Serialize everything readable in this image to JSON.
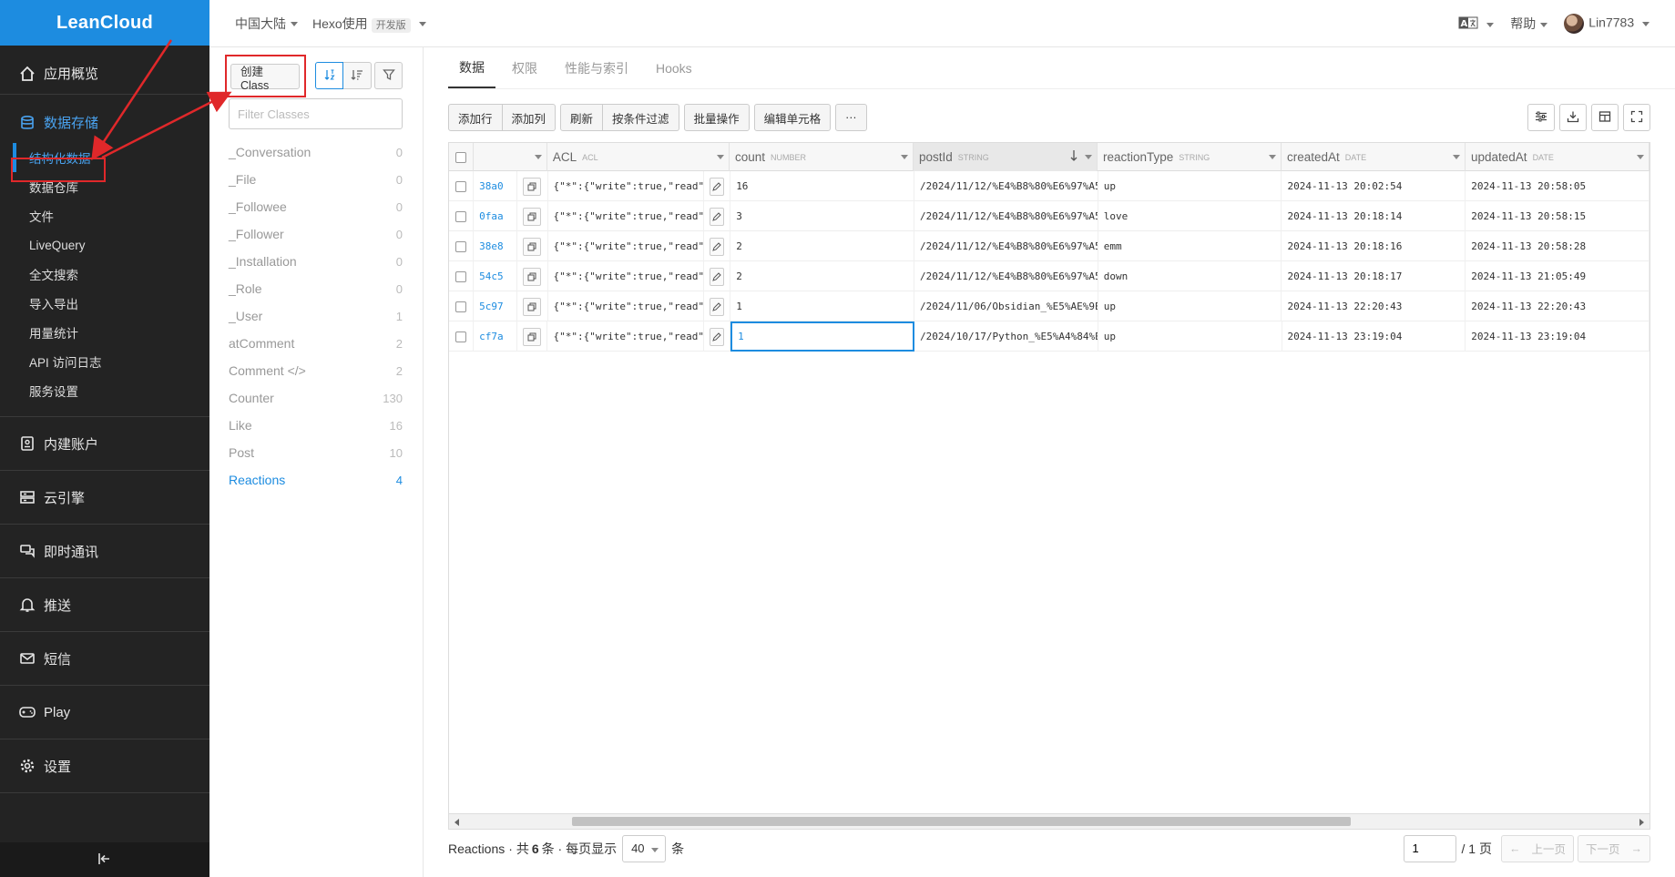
{
  "sidebar": {
    "logo": "LeanCloud",
    "overview": "应用概览",
    "storage": "数据存储",
    "storage_items": [
      {
        "label": "结构化数据"
      },
      {
        "label": "数据仓库"
      },
      {
        "label": "文件"
      },
      {
        "label": "LiveQuery"
      },
      {
        "label": "全文搜索"
      },
      {
        "label": "导入导出"
      },
      {
        "label": "用量统计"
      },
      {
        "label": "API 访问日志"
      },
      {
        "label": "服务设置"
      }
    ],
    "sections": [
      {
        "label": "内建账户"
      },
      {
        "label": "云引擎"
      },
      {
        "label": "即时通讯"
      },
      {
        "label": "推送"
      },
      {
        "label": "短信"
      },
      {
        "label": "Play"
      },
      {
        "label": "设置"
      }
    ]
  },
  "topbar": {
    "region": "中国大陆",
    "app": "Hexo使用",
    "app_badge": "开发版",
    "help": "帮助",
    "user": "Lin7783",
    "lang_icon": "translate-icon"
  },
  "classes": {
    "create_label": "创建 Class",
    "filter_placeholder": "Filter Classes",
    "items": [
      {
        "name": "_Conversation",
        "count": "0"
      },
      {
        "name": "_File",
        "count": "0"
      },
      {
        "name": "_Followee",
        "count": "0"
      },
      {
        "name": "_Follower",
        "count": "0"
      },
      {
        "name": "_Installation",
        "count": "0"
      },
      {
        "name": "_Role",
        "count": "0"
      },
      {
        "name": "_User",
        "count": "1"
      },
      {
        "name": "atComment",
        "count": "2"
      },
      {
        "name": "Comment </>",
        "count": "2"
      },
      {
        "name": "Counter",
        "count": "130"
      },
      {
        "name": "Like",
        "count": "16"
      },
      {
        "name": "Post",
        "count": "10"
      },
      {
        "name": "Reactions",
        "count": "4"
      }
    ]
  },
  "tabs": [
    "数据",
    "权限",
    "性能与索引",
    "Hooks"
  ],
  "toolbar": {
    "group1": [
      "添加行",
      "添加列"
    ],
    "group2": [
      "刷新",
      "按条件过滤"
    ],
    "group3": [
      "批量操作"
    ],
    "group4": [
      "编辑单元格"
    ],
    "more": "···"
  },
  "table": {
    "columns": [
      {
        "name": "ACL",
        "type": "ACL"
      },
      {
        "name": "count",
        "type": "NUMBER"
      },
      {
        "name": "postId",
        "type": "STRING"
      },
      {
        "name": "reactionType",
        "type": "STRING"
      },
      {
        "name": "createdAt",
        "type": "DATE"
      },
      {
        "name": "updatedAt",
        "type": "DATE"
      }
    ],
    "rows": [
      {
        "id": "38a0",
        "acl": "{\"*\":{\"write\":true,\"read\"…",
        "count": "16",
        "postId": "/2024/11/12/%E4%B8%80%E6%97%A5%E",
        "reaction": "up",
        "created": "2024-11-13 20:02:54",
        "updated": "2024-11-13 20:58:05"
      },
      {
        "id": "0faa",
        "acl": "{\"*\":{\"write\":true,\"read\"…",
        "count": "3",
        "postId": "/2024/11/12/%E4%B8%80%E6%97%A5%E",
        "reaction": "love",
        "created": "2024-11-13 20:18:14",
        "updated": "2024-11-13 20:58:15"
      },
      {
        "id": "38e8",
        "acl": "{\"*\":{\"write\":true,\"read\"…",
        "count": "2",
        "postId": "/2024/11/12/%E4%B8%80%E6%97%A5%E",
        "reaction": "emm",
        "created": "2024-11-13 20:18:16",
        "updated": "2024-11-13 20:58:28"
      },
      {
        "id": "54c5",
        "acl": "{\"*\":{\"write\":true,\"read\"…",
        "count": "2",
        "postId": "/2024/11/12/%E4%B8%80%E6%97%A5%E",
        "reaction": "down",
        "created": "2024-11-13 20:18:17",
        "updated": "2024-11-13 21:05:49"
      },
      {
        "id": "5c97",
        "acl": "{\"*\":{\"write\":true,\"read\"…",
        "count": "1",
        "postId": "/2024/11/06/Obsidian_%E5%AE%9E%E",
        "reaction": "up",
        "created": "2024-11-13 22:20:43",
        "updated": "2024-11-13 22:20:43"
      },
      {
        "id": "cf7a",
        "acl": "{\"*\":{\"write\":true,\"read\"…",
        "count": "1",
        "postId": "/2024/10/17/Python_%E5%A4%84%E7",
        "reaction": "up",
        "created": "2024-11-13 23:19:04",
        "updated": "2024-11-13 23:19:04"
      }
    ]
  },
  "footer": {
    "class_name": "Reactions",
    "total_prefix": "· 共",
    "total": "6",
    "total_suffix": "条 · 每页显示",
    "page_size": "40",
    "unit": "条",
    "page": "1",
    "page_total": "/ 1 页",
    "prev": "上一页",
    "next": "下一页"
  },
  "colors": {
    "accent": "#1d8ce0",
    "annotation": "#e0282a",
    "sidebar": "#232323"
  }
}
